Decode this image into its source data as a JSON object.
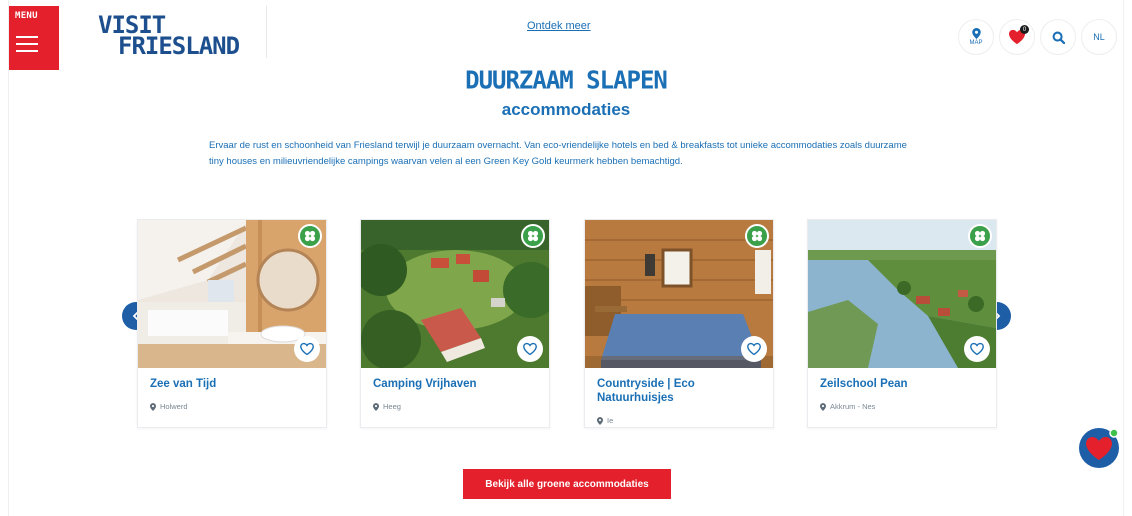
{
  "header": {
    "menu_label": "MENU",
    "logo_line1": "VISIT",
    "logo_line2": "FRIESLAND",
    "top_link": "Ontdek meer",
    "map_label": "MAP",
    "favorites_count": "0",
    "language": "NL"
  },
  "section": {
    "title": "DUURZAAM SLAPEN",
    "subtitle": "accommodaties",
    "intro": "Ervaar de rust en schoonheid van Friesland terwijl je duurzaam overnacht. Van eco-vriendelijke hotels en bed & breakfasts tot unieke accommodaties zoals duurzame tiny houses en milieuvriendelijke campings waarvan velen al een Green Key Gold keurmerk hebben bemachtigd."
  },
  "cards": [
    {
      "name": "Zee van Tijd",
      "location": "Holwerd"
    },
    {
      "name": "Camping Vrijhaven",
      "location": "Heeg"
    },
    {
      "name": "Countryside | Eco Natuurhuisjes",
      "location": "Ie"
    },
    {
      "name": "Zeilschool Pean",
      "location": "Akkrum - Nes"
    }
  ],
  "cta_label": "Bekijk alle groene accommodaties",
  "colors": {
    "brand_red": "#e3202b",
    "brand_blue": "#1a6fb5",
    "dark_blue": "#1d4f8f",
    "eco_green": "#3aa14a"
  }
}
